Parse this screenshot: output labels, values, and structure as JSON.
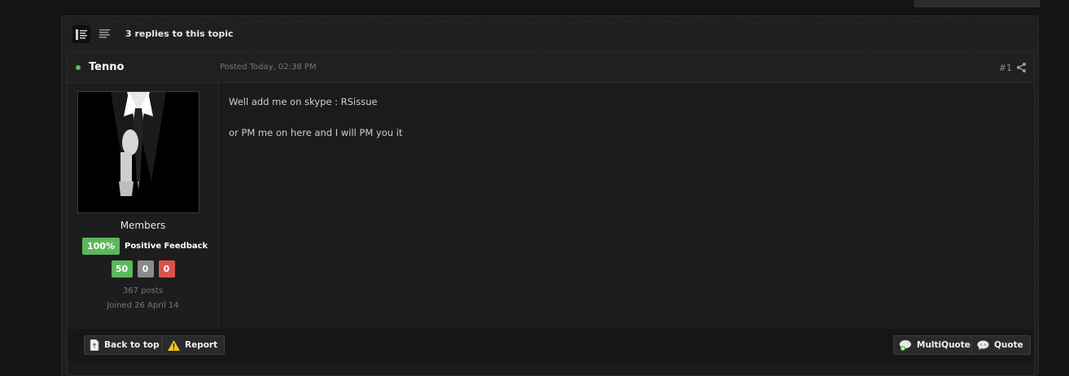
{
  "topic": {
    "reply_count_label": "3 replies to this topic"
  },
  "post": {
    "author": "Tenno",
    "posted": "Posted Today, 02:38 PM",
    "number": "#1",
    "author_info": {
      "group": "Members",
      "feedback_percent": "100%",
      "feedback_label": "Positive Feedback",
      "positive_count": "50",
      "neutral_count": "0",
      "negative_count": "0",
      "posts": "367 posts",
      "joined": "Joined 26 April 14"
    },
    "content": [
      "Well add me on skype : RSissue",
      "or PM me on here and I will PM you it"
    ]
  },
  "actions": {
    "back_to_top": "Back to top",
    "report": "Report",
    "multiquote": "MultiQuote",
    "quote": "Quote"
  },
  "icons": [
    "list-view-icon",
    "compact-view-icon",
    "share-icon",
    "page-icon",
    "warning-icon",
    "multiquote-icon",
    "quote-icon"
  ],
  "colors": {
    "online": "#5cb85c",
    "positive": "#5cb85c",
    "neutral": "#8a8a8a",
    "negative": "#d9534f"
  }
}
